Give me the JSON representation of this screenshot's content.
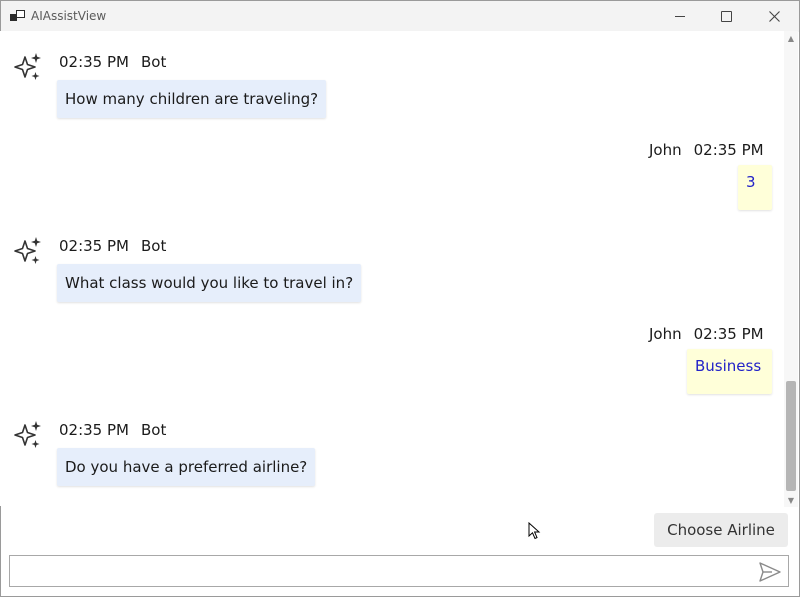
{
  "window": {
    "title": "AIAssistView"
  },
  "messages": [
    {
      "role": "bot",
      "time": "02:35 PM",
      "author": "Bot",
      "text": "How many children are traveling?"
    },
    {
      "role": "user",
      "time": "02:35 PM",
      "author": "John",
      "text": "3"
    },
    {
      "role": "bot",
      "time": "02:35 PM",
      "author": "Bot",
      "text": "What class would you like to travel in?"
    },
    {
      "role": "user",
      "time": "02:35 PM",
      "author": "John",
      "text": "Business"
    },
    {
      "role": "bot",
      "time": "02:35 PM",
      "author": "Bot",
      "text": "Do you have a preferred airline?"
    }
  ],
  "suggestion": {
    "label": "Choose Airline"
  },
  "input": {
    "value": "",
    "placeholder": ""
  },
  "icons": {
    "bot_avatar": "sparkle-icon",
    "send": "send-icon"
  },
  "colors": {
    "bot_bubble": "#e6eefb",
    "user_bubble": "#ffffd9",
    "user_text": "#2323c8"
  }
}
